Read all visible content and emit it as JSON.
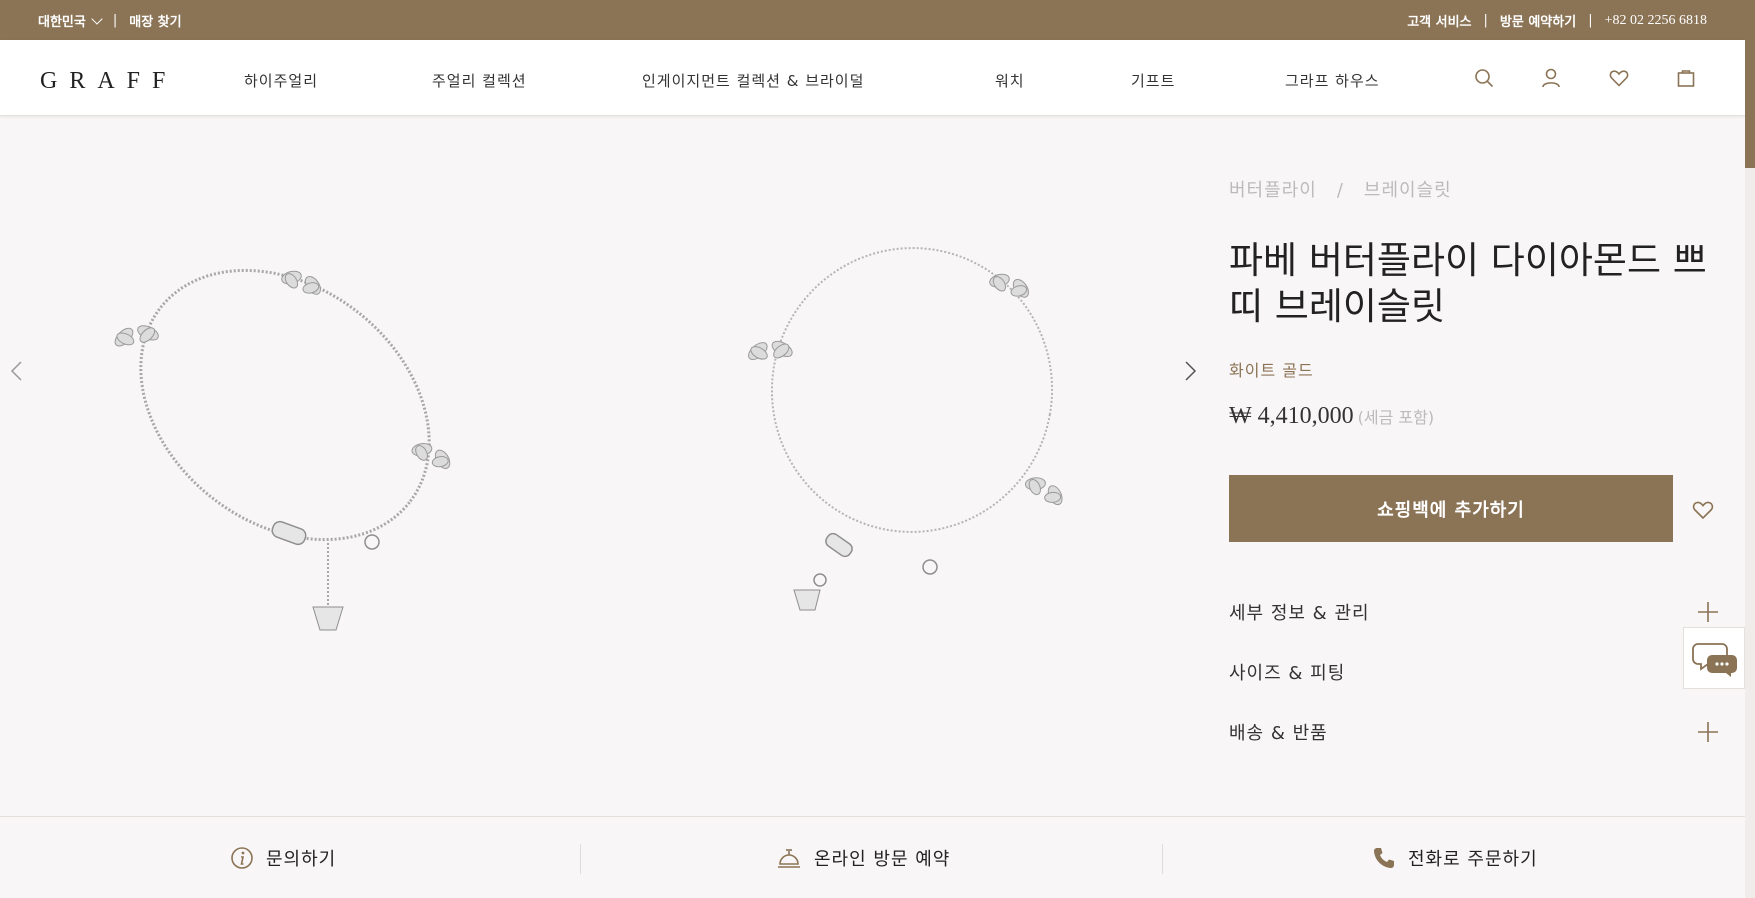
{
  "topbar": {
    "country": "대한민국",
    "store_finder": "매장 찾기",
    "customer_service": "고객 서비스",
    "book_appointment": "방문 예약하기",
    "phone": "+82 02 2256 6818"
  },
  "nav": {
    "logo": "GRAFF",
    "items": [
      "하이주얼리",
      "주얼리 컬렉션",
      "인게이지먼트 컬렉션 & 브라이덜",
      "워치",
      "기프트",
      "그라프 하우스"
    ]
  },
  "product": {
    "breadcrumb": [
      "버터플라이",
      "브레이슬릿"
    ],
    "breadcrumb_sep": "/",
    "title": "파베 버터플라이 다이아몬드 쁘띠 브레이슬릿",
    "metal": "화이트 골드",
    "price": "₩ 4,410,000",
    "tax_note": "(세금 포함)",
    "add_to_bag": "쇼핑백에 추가하기",
    "accordion": [
      "세부 정보 & 관리",
      "사이즈 & 피팅",
      "배송 & 반품"
    ]
  },
  "footer": {
    "inquiry": "문의하기",
    "online_appointment": "온라인 방문 예약",
    "order_by_phone": "전화로 주문하기"
  },
  "colors": {
    "brand": "#8b7355",
    "background": "#f8f6f6",
    "muted": "#bbbbbb"
  },
  "icons": [
    "chevron-down-icon",
    "search-icon",
    "user-icon",
    "heart-icon",
    "bag-icon",
    "chevron-left-icon",
    "chevron-right-icon",
    "plus-icon",
    "chat-icon",
    "info-icon",
    "bell-icon",
    "phone-icon"
  ]
}
